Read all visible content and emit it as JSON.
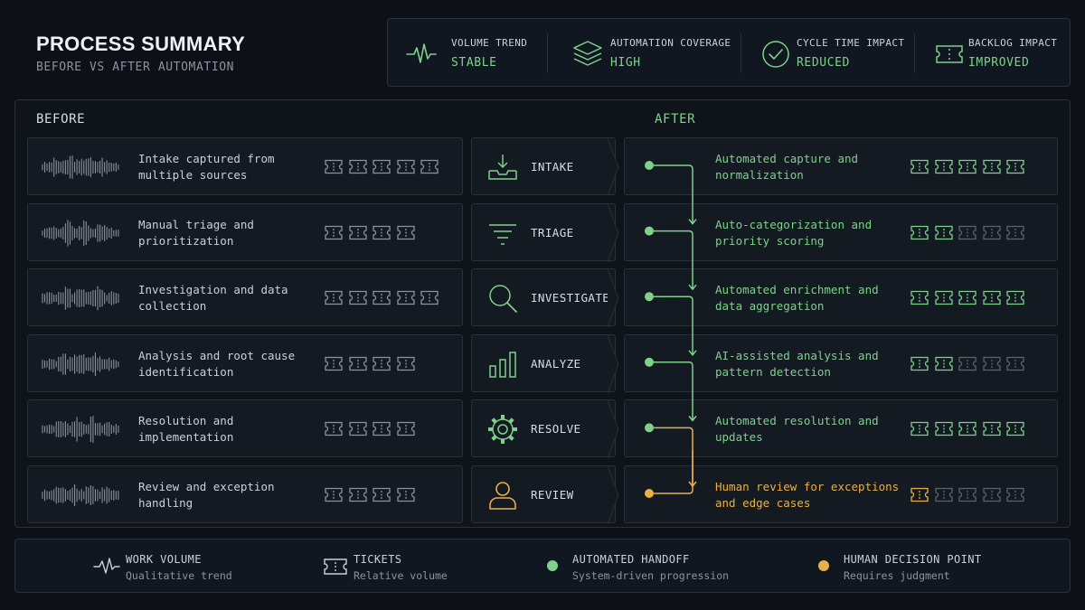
{
  "header": {
    "title": "PROCESS SUMMARY",
    "subtitle": "BEFORE VS AFTER AUTOMATION"
  },
  "kpis": [
    {
      "label": "VOLUME TREND",
      "value": "STABLE",
      "icon": "pulse-icon"
    },
    {
      "label": "AUTOMATION COVERAGE",
      "value": "HIGH",
      "icon": "layers-icon"
    },
    {
      "label": "CYCLE TIME IMPACT",
      "value": "REDUCED",
      "icon": "check-circle-icon"
    },
    {
      "label": "BACKLOG IMPACT",
      "value": "IMPROVED",
      "icon": "ticket-icon"
    }
  ],
  "columns": {
    "before": "BEFORE",
    "after": "AFTER"
  },
  "rows": [
    {
      "stage": "INTAKE",
      "icon": "inbox-download-icon",
      "before": "Intake captured from multiple sources",
      "after": "Automated capture and normalization",
      "before_tickets": 5,
      "after_tickets": 5,
      "after_tickets_active": 5,
      "human": false
    },
    {
      "stage": "TRIAGE",
      "icon": "filter-icon",
      "before": "Manual triage and prioritization",
      "after": "Auto-categorization and priority scoring",
      "before_tickets": 4,
      "after_tickets": 5,
      "after_tickets_active": 2,
      "human": false
    },
    {
      "stage": "INVESTIGATE",
      "icon": "search-icon",
      "before": "Investigation and data collection",
      "after": "Automated enrichment and data aggregation",
      "before_tickets": 5,
      "after_tickets": 5,
      "after_tickets_active": 5,
      "human": false
    },
    {
      "stage": "ANALYZE",
      "icon": "bar-chart-icon",
      "before": "Analysis and root cause identification",
      "after": "AI-assisted analysis and pattern detection",
      "before_tickets": 4,
      "after_tickets": 5,
      "after_tickets_active": 2,
      "human": false
    },
    {
      "stage": "RESOLVE",
      "icon": "gear-icon",
      "before": "Resolution and implementation",
      "after": "Automated resolution and updates",
      "before_tickets": 4,
      "after_tickets": 5,
      "after_tickets_active": 5,
      "human": false
    },
    {
      "stage": "REVIEW",
      "icon": "user-icon",
      "before": "Review and exception handling",
      "after": "Human review for exceptions and edge cases",
      "before_tickets": 4,
      "after_tickets": 5,
      "after_tickets_active": 1,
      "human": true
    }
  ],
  "legend": [
    {
      "title": "WORK VOLUME",
      "sub": "Qualitative trend",
      "icon": "pulse-icon"
    },
    {
      "title": "TICKETS",
      "sub": "Relative volume",
      "icon": "ticket-icon"
    },
    {
      "title": "AUTOMATED HANDOFF",
      "sub": "System-driven progression",
      "icon": "green-dot"
    },
    {
      "title": "HUMAN DECISION POINT",
      "sub": "Requires judgment",
      "icon": "orange-dot"
    }
  ],
  "colors": {
    "background": "#0d1117",
    "accent_green": "#7fd18b",
    "accent_orange": "#e9b04a",
    "muted": "#8b949e",
    "border": "#2a313b"
  }
}
